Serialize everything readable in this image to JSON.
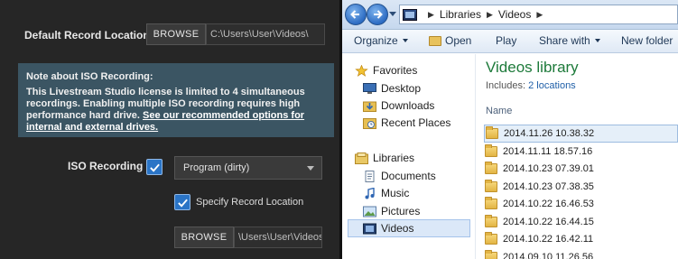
{
  "studio": {
    "default_record_label": "Default Record Location",
    "browse_label": "BROWSE",
    "default_path": "C:\\Users\\User\\Videos\\",
    "note_title": "Note about ISO Recording:",
    "note_body": "This Livestream Studio license is limited to 4 simultaneous recordings. Enabling multiple ISO recording requires high performance hard drive. ",
    "note_link": "See our recommended options for internal and external drives.",
    "iso_label": "ISO Recording",
    "iso_checked": true,
    "iso_select_value": "Program (dirty)",
    "specify_label": "Specify Record Location",
    "specify_checked": true,
    "browse2_label": "BROWSE",
    "iso_path": "\\Users\\User\\Videos\\"
  },
  "explorer": {
    "breadcrumb": [
      "Libraries",
      "Videos"
    ],
    "toolbar": {
      "organize": "Organize",
      "open": "Open",
      "play": "Play",
      "share_with": "Share with",
      "new_folder": "New folder"
    },
    "nav": {
      "favorites": "Favorites",
      "desktop": "Desktop",
      "downloads": "Downloads",
      "recent_places": "Recent Places",
      "libraries": "Libraries",
      "documents": "Documents",
      "music": "Music",
      "pictures": "Pictures",
      "videos": "Videos"
    },
    "library_title": "Videos library",
    "includes_prefix": "Includes:",
    "includes_link": "2 locations",
    "column_name": "Name",
    "files": [
      "2014.11.26 10.38.32",
      "2014.11.11 18.57.16",
      "2014.10.23 07.39.01",
      "2014.10.23 07.38.35",
      "2014.10.22 16.46.53",
      "2014.10.22 16.44.15",
      "2014.10.22 16.42.11",
      "2014.09.10 11.26.56"
    ]
  },
  "colors": {
    "studio_bg": "#262626",
    "note_bg": "#3b5563",
    "checkbox_blue": "#2a74c6",
    "library_title_green": "#1d7a3a",
    "link_blue": "#1f5fa8"
  }
}
